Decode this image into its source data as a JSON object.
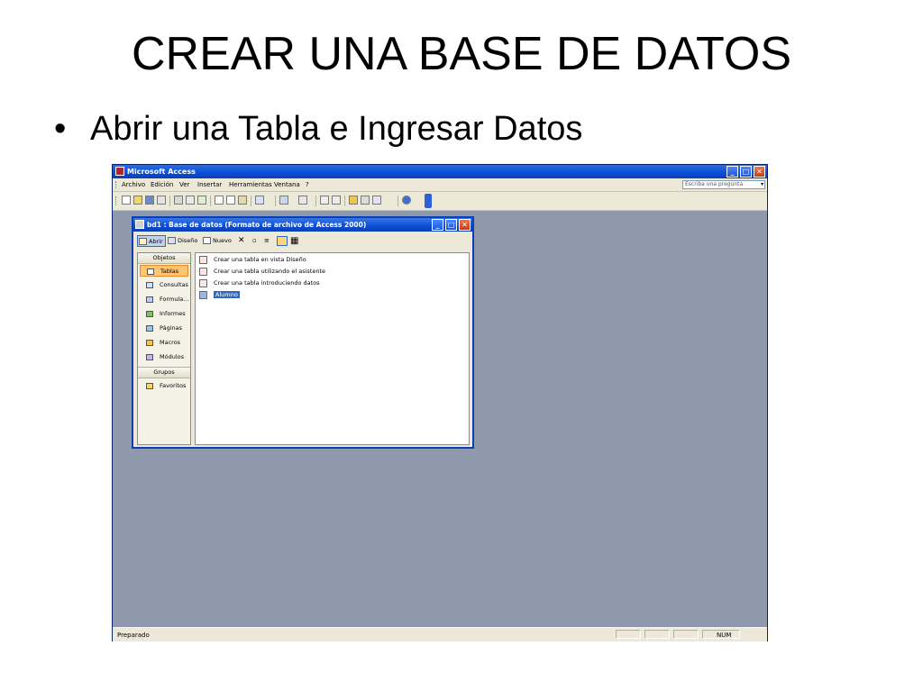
{
  "slide": {
    "title": "CREAR UNA BASE DE DATOS",
    "bullet_marker": "•",
    "bullet": "Abrir una Tabla e Ingresar Datos"
  },
  "app": {
    "title": "Microsoft Access",
    "window_buttons": [
      "_",
      "□",
      "✕"
    ],
    "menu": [
      "Archivo",
      "Edición",
      "Ver",
      "Insertar",
      "Herramientas",
      "Ventana",
      "?"
    ],
    "help_placeholder": "Escriba una pregunta",
    "status_text": "Preparado",
    "status_num": "NUM",
    "colors": {
      "title_blue": "#0a4dd6",
      "workspace": "#8f99ae",
      "chrome": "#ece9d8",
      "selected_orange": "#ffc56f"
    }
  },
  "db_window": {
    "title": "bd1 : Base de datos (Formato de archivo de Access 2000)",
    "window_buttons": [
      "_",
      "□",
      "✕"
    ],
    "toolbar": {
      "open_label": "Abrir",
      "design_label": "Diseño",
      "new_label": "Nuevo",
      "delete_glyph": "✕",
      "icons": [
        "open-icon",
        "design-icon",
        "new-icon",
        "delete-icon",
        "large-icons-icon",
        "small-icons-icon",
        "list-view-icon",
        "details-view-icon"
      ]
    },
    "objects_header": "Objetos",
    "objects": [
      {
        "label": "Tablas",
        "icon": "table-icon",
        "selected": true
      },
      {
        "label": "Consultas",
        "icon": "query-icon"
      },
      {
        "label": "Formula...",
        "icon": "form-icon"
      },
      {
        "label": "Informes",
        "icon": "report-icon"
      },
      {
        "label": "Páginas",
        "icon": "page-icon"
      },
      {
        "label": "Macros",
        "icon": "macro-icon"
      },
      {
        "label": "Módulos",
        "icon": "module-icon"
      }
    ],
    "groups_header": "Grupos",
    "groups": [
      {
        "label": "Favoritos",
        "icon": "favorites-icon"
      }
    ],
    "list": [
      {
        "label": "Crear una tabla en vista Diseño",
        "icon": "design-wizard-icon"
      },
      {
        "label": "Crear una tabla utilizando el asistente",
        "icon": "wizard-icon"
      },
      {
        "label": "Crear una tabla introduciendo datos",
        "icon": "datasheet-icon"
      },
      {
        "label": "Alumno",
        "icon": "table-icon",
        "selected": true
      }
    ]
  }
}
